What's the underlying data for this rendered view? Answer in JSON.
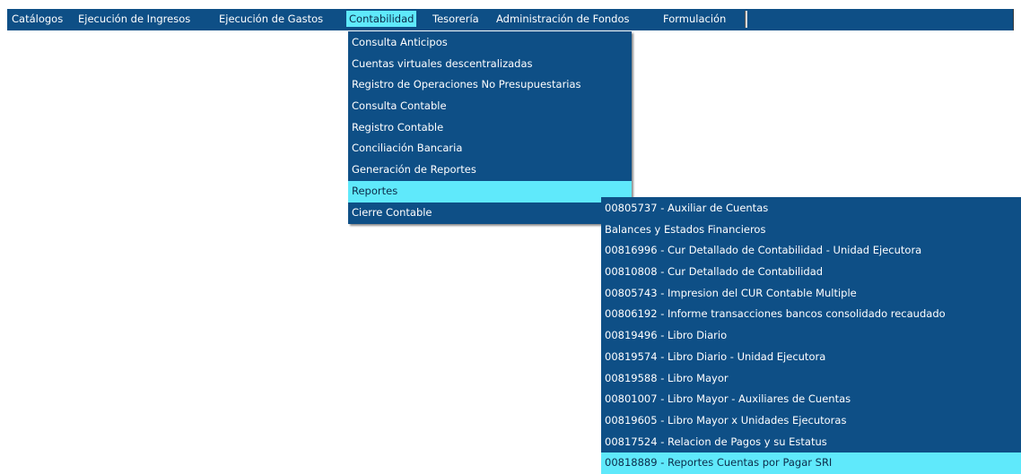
{
  "menubar": {
    "items": [
      {
        "label": "Catálogos"
      },
      {
        "label": "Ejecución de Ingresos"
      },
      {
        "label": "Ejecución de Gastos"
      },
      {
        "label": "Contabilidad",
        "active": true
      },
      {
        "label": "Tesorería"
      },
      {
        "label": "Administración de Fondos"
      },
      {
        "label": "Formulación"
      }
    ]
  },
  "contabilidad_menu": {
    "items": [
      {
        "label": "Consulta Anticipos"
      },
      {
        "label": "Cuentas virtuales descentralizadas"
      },
      {
        "label": "Registro de Operaciones No Presupuestarias"
      },
      {
        "label": "Consulta Contable"
      },
      {
        "label": "Registro Contable"
      },
      {
        "label": "Conciliación Bancaria"
      },
      {
        "label": "Generación de Reportes"
      },
      {
        "label": "Reportes",
        "highlighted": true
      },
      {
        "label": "Cierre Contable"
      }
    ]
  },
  "reportes_submenu": {
    "items": [
      {
        "label": "00805737 - Auxiliar de Cuentas"
      },
      {
        "label": "Balances y Estados Financieros"
      },
      {
        "label": "00816996 - Cur Detallado de Contabilidad - Unidad Ejecutora"
      },
      {
        "label": "00810808 - Cur Detallado de Contabilidad"
      },
      {
        "label": "00805743 - Impresion del CUR Contable Multiple"
      },
      {
        "label": "00806192 - Informe transacciones bancos consolidado recaudado"
      },
      {
        "label": "00819496 - Libro Diario"
      },
      {
        "label": "00819574 - Libro Diario - Unidad Ejecutora"
      },
      {
        "label": "00819588 - Libro Mayor"
      },
      {
        "label": "00801007 - Libro Mayor - Auxiliares de Cuentas"
      },
      {
        "label": "00819605 - Libro Mayor x Unidades Ejecutoras"
      },
      {
        "label": "00817524 - Relacion de Pagos y su Estatus"
      },
      {
        "label": "00818889 - Reportes Cuentas por Pagar SRI",
        "highlighted": true
      }
    ]
  },
  "colors": {
    "menu_background": "#0e4f86",
    "highlight": "#5fe9fb",
    "page_background": "#ffffff"
  }
}
